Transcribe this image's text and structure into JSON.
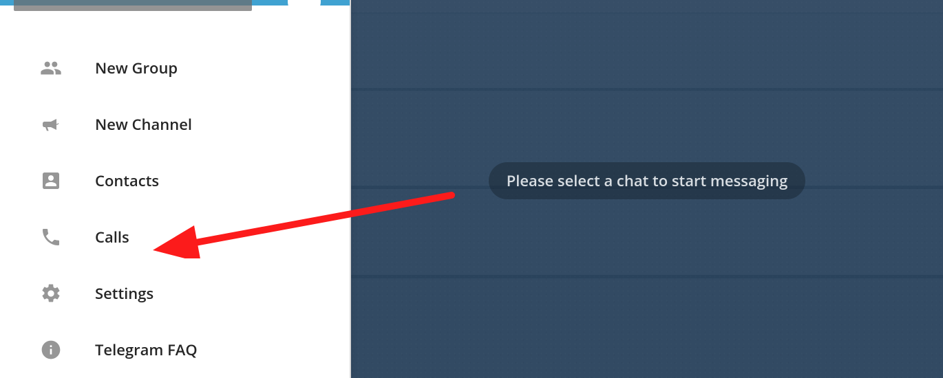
{
  "menu": {
    "items": [
      {
        "label": "New Group",
        "icon": "group-icon"
      },
      {
        "label": "New Channel",
        "icon": "megaphone-icon"
      },
      {
        "label": "Contacts",
        "icon": "contact-icon"
      },
      {
        "label": "Calls",
        "icon": "phone-icon"
      },
      {
        "label": "Settings",
        "icon": "gear-icon"
      },
      {
        "label": "Telegram FAQ",
        "icon": "info-icon"
      }
    ]
  },
  "main": {
    "prompt": "Please select a chat to start messaging"
  },
  "colors": {
    "header": "#40a2d1",
    "icon": "#969696",
    "text": "#262626",
    "arrow": "#fc1b1b"
  }
}
